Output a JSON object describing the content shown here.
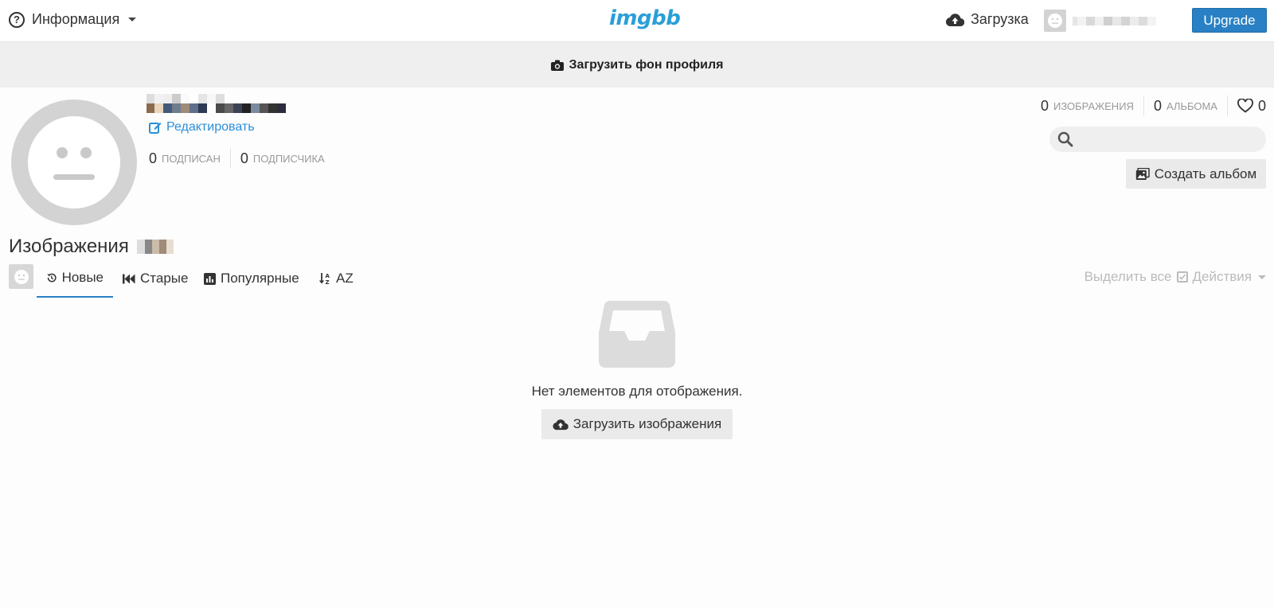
{
  "header": {
    "info_label": "Информация",
    "logo": "imgbb",
    "upload_label": "Загрузка",
    "upgrade_label": "Upgrade",
    "icons": {
      "info": "question-circle-icon",
      "upload": "cloud-upload-icon"
    }
  },
  "profile_bg": {
    "label": "Загрузить фон профиля",
    "icon": "camera-icon"
  },
  "profile": {
    "edit_label": "Редактировать",
    "following_count": "0",
    "following_label": "подписан",
    "followers_count": "0",
    "followers_label": "подписчика",
    "images_count": "0",
    "images_label": "изображения",
    "albums_count": "0",
    "albums_label": "альбома",
    "likes_count": "0"
  },
  "search": {
    "placeholder": ""
  },
  "create_album_label": "Создать альбом",
  "images_section": {
    "title": "Изображения",
    "tabs": [
      {
        "label": "Новые",
        "icon": "history-icon",
        "active": true
      },
      {
        "label": "Старые",
        "icon": "backward-icon",
        "active": false
      },
      {
        "label": "Популярные",
        "icon": "bar-chart-icon",
        "active": false
      },
      {
        "label": "AZ",
        "icon": "sort-alpha-icon",
        "active": false
      }
    ],
    "select_all_label": "Выделить все",
    "actions_label": "Действия"
  },
  "empty_state": {
    "message": "Нет элементов для отображения.",
    "button_label": "Загрузить изображения",
    "icon": "inbox-icon"
  },
  "colors": {
    "accent": "#2980c4",
    "link": "#2a8fd8",
    "logo": "#2a9fd8",
    "muted": "#999999"
  }
}
